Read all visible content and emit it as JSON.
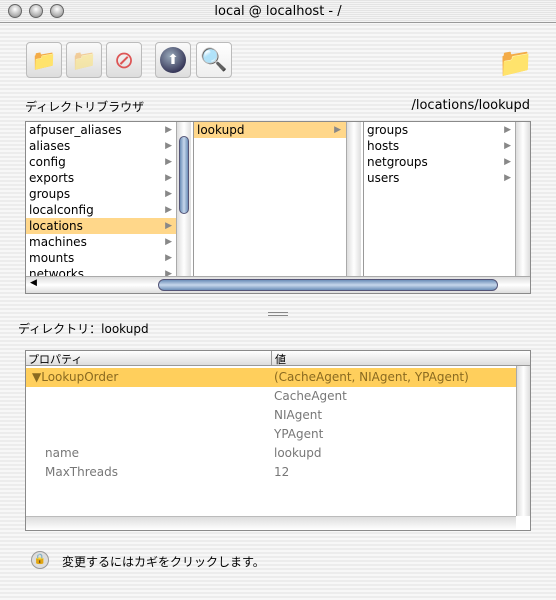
{
  "window": {
    "title": "local @ localhost - /"
  },
  "toolbar": {
    "buttons": [
      {
        "name": "new-directory",
        "icon": "folder-plus-icon"
      },
      {
        "name": "duplicate",
        "icon": "folders-icon"
      },
      {
        "name": "delete",
        "icon": "no-entry-icon"
      },
      {
        "name": "domain",
        "icon": "globe-icon"
      },
      {
        "name": "search",
        "icon": "magnifier-icon"
      }
    ]
  },
  "browser": {
    "label": "ディレクトリブラウザ",
    "path": "/locations/lookupd",
    "columns": [
      {
        "items": [
          "afpuser_aliases",
          "aliases",
          "config",
          "exports",
          "groups",
          "localconfig",
          "locations",
          "machines",
          "mounts",
          "networks"
        ],
        "selected": "locations"
      },
      {
        "items": [
          "lookupd"
        ],
        "selected": "lookupd"
      },
      {
        "items": [
          "groups",
          "hosts",
          "netgroups",
          "users"
        ]
      }
    ]
  },
  "directory": {
    "label": "ディレクトリ：lookupd"
  },
  "table": {
    "headers": [
      "プロパティ",
      "値"
    ],
    "rows": [
      {
        "property": "▼LookupOrder",
        "value": "(CacheAgent, NIAgent, YPAgent)",
        "selected": true
      },
      {
        "property": "",
        "value": "CacheAgent"
      },
      {
        "property": "",
        "value": "NIAgent"
      },
      {
        "property": "",
        "value": "YPAgent"
      },
      {
        "property": "name",
        "value": "lookupd"
      },
      {
        "property": "MaxThreads",
        "value": "12"
      }
    ]
  },
  "status": {
    "lock_text": "変更するにはカギをクリックします。"
  },
  "colors": {
    "selection": "#ffd78a",
    "table_selection": "#ffcf5c"
  }
}
